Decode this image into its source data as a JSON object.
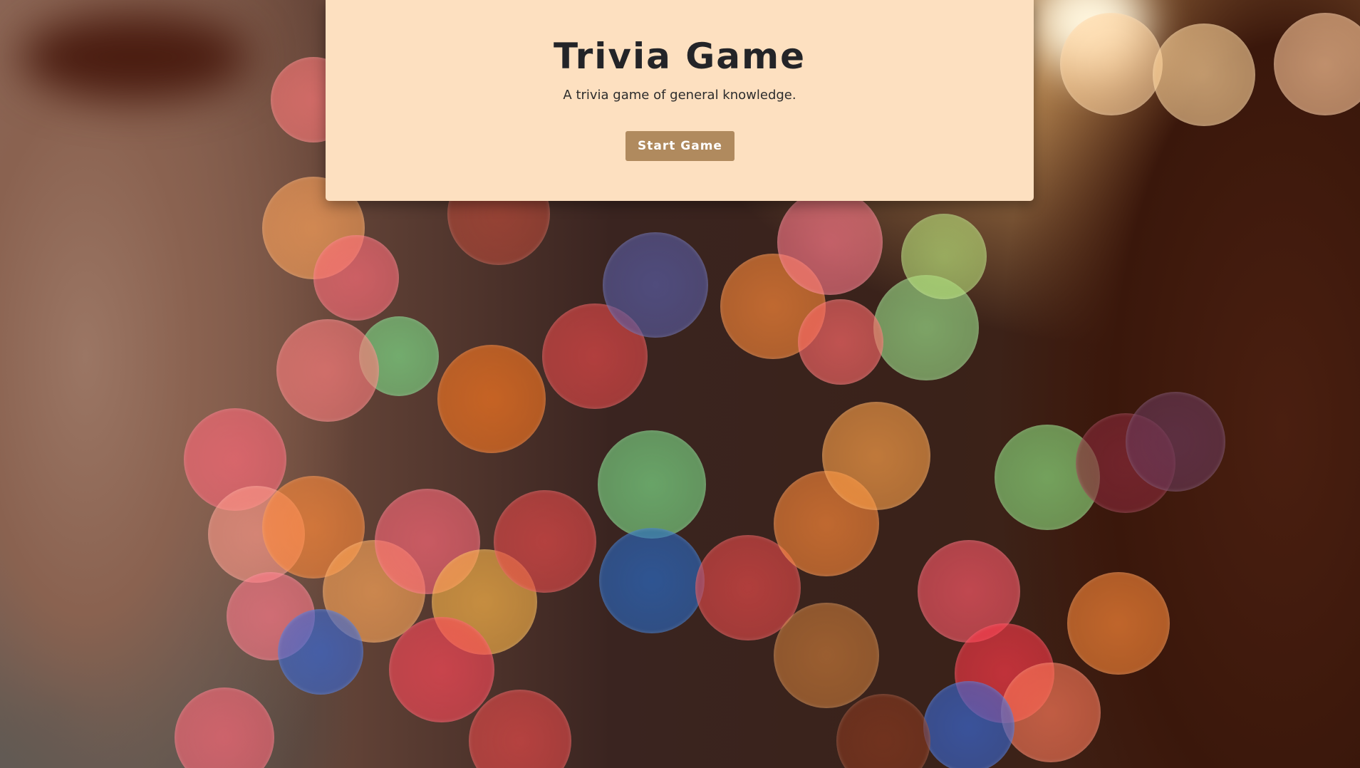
{
  "page": {
    "title": "Trivia Game",
    "subtitle": "A trivia game of general knowledge.",
    "start_button_label": "Start Game"
  },
  "colors": {
    "card_background": "#fde0c0",
    "title_text": "#232428",
    "button_background": "#b08a5e",
    "button_text": "#ffffff"
  },
  "background": {
    "description_icon": "bokeh-lights-background"
  }
}
